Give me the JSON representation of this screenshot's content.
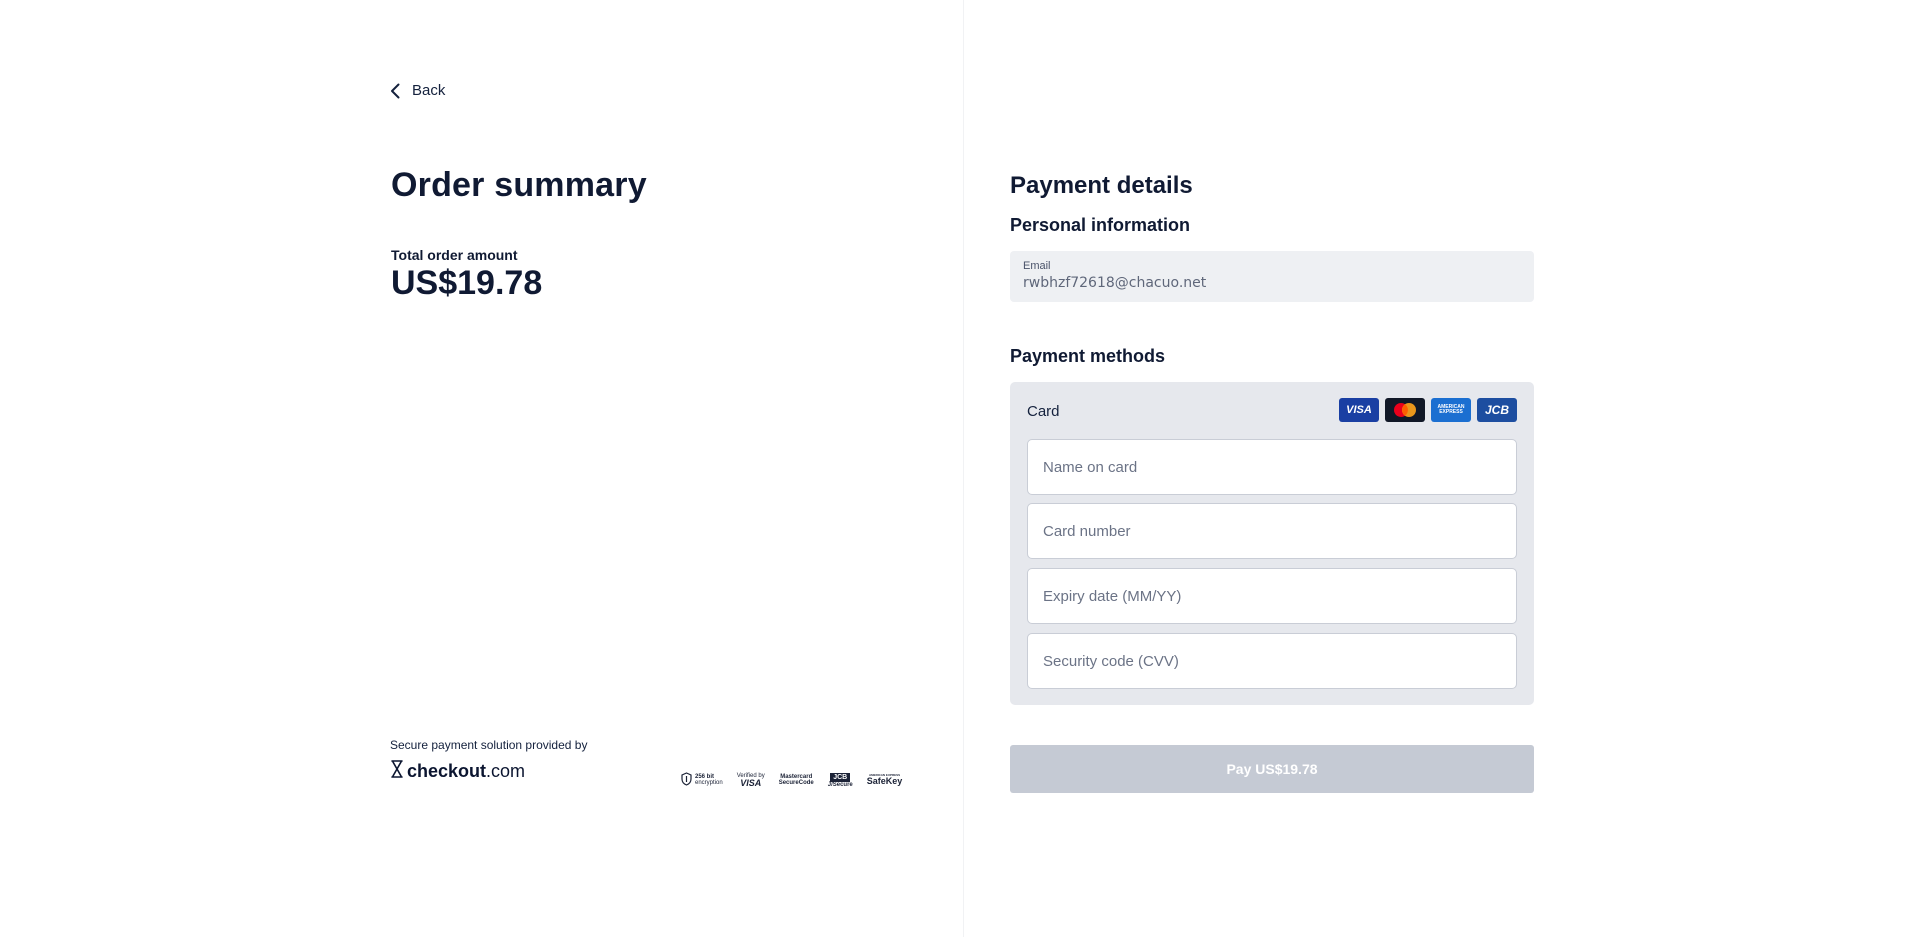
{
  "left": {
    "back_label": "Back",
    "order_title": "Order summary",
    "total_label": "Total order amount",
    "total_amount": "US$19.78",
    "secure_text": "Secure payment solution provided by",
    "brand_bold": "checkout",
    "brand_suffix": ".com",
    "trust_badges": {
      "encryption_top": "256 bit",
      "encryption_bottom": "encryption",
      "visa_top": "Verified by",
      "visa_bottom": "VISA",
      "mc_top": "Mastercard",
      "mc_bottom": "SecureCode",
      "jcb_top": "JCB",
      "jcb_bottom": "J/Secure",
      "safekey_top": "AMERICAN EXPRESS",
      "safekey_bottom": "SafeKey"
    }
  },
  "right": {
    "payment_title": "Payment details",
    "personal_title": "Personal information",
    "email": {
      "label": "Email",
      "value": "rwbhzf72618@chacuo.net"
    },
    "methods_title": "Payment methods",
    "card": {
      "label": "Card",
      "brands": {
        "visa": "VISA",
        "amex": "AMERICAN EXPRESS",
        "jcb": "JCB"
      },
      "name_placeholder": "Name on card",
      "number_placeholder": "Card number",
      "expiry_placeholder": "Expiry date (MM/YY)",
      "cvv_placeholder": "Security code (CVV)"
    },
    "pay_button": "Pay US$19.78"
  },
  "colors": {
    "text_primary": "#101a33",
    "panel_bg": "#e6e8ed",
    "email_bg": "#eef0f3",
    "button_disabled": "#c5cad4",
    "visa_blue": "#1a3fa3",
    "mc_dark": "#111827",
    "amex_blue": "#1b6fd1",
    "jcb_blue": "#1d4ea0"
  },
  "icons": [
    "chevron-left-icon",
    "checkout-logo-icon",
    "shield-icon",
    "visa-icon",
    "mastercard-icon",
    "amex-icon",
    "jcb-icon"
  ]
}
